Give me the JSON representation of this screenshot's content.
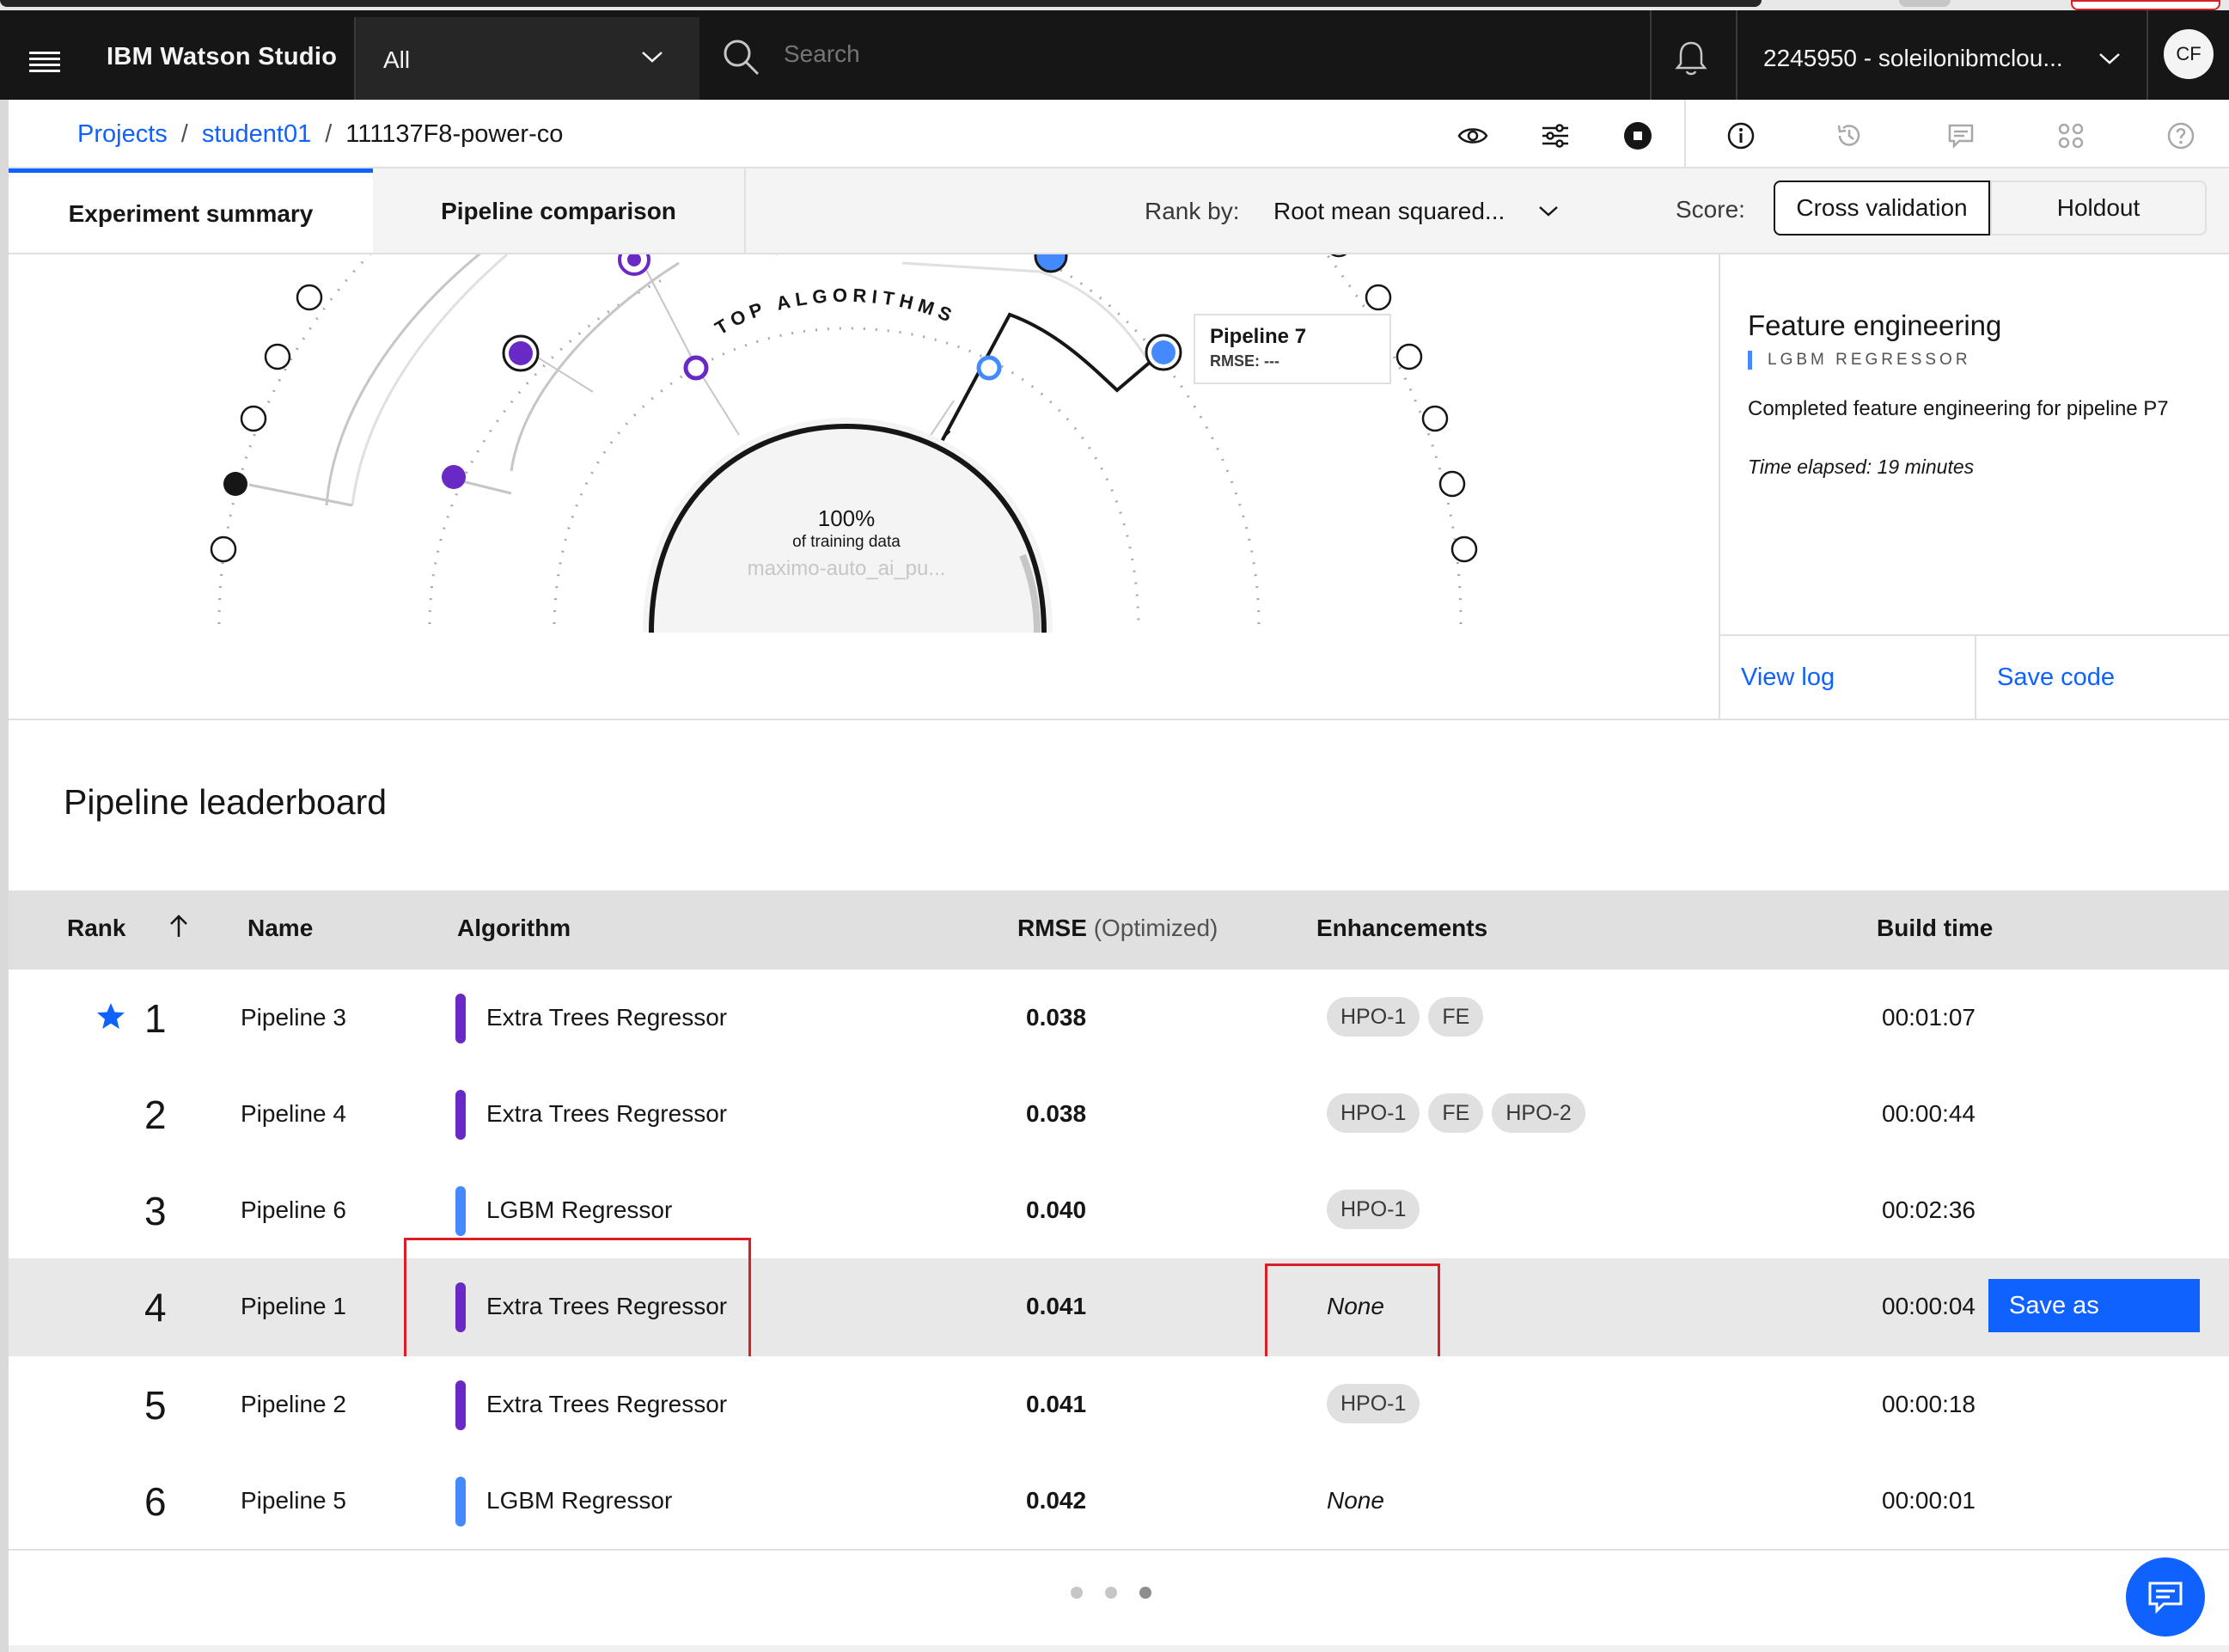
{
  "header": {
    "app_name_bold": "IBM",
    "app_name_rest": "Watson Studio",
    "scope_value": "All",
    "search_placeholder": "Search",
    "account": "2245950 - soleilonibmclou...",
    "avatar_initials": "CF"
  },
  "breadcrumb": {
    "items": [
      "Projects",
      "student01"
    ],
    "current": "111137F8-power-co",
    "separator": "/"
  },
  "tabs": {
    "experiment_summary": "Experiment summary",
    "pipeline_comparison": "Pipeline comparison"
  },
  "controls": {
    "rank_by_label": "Rank by:",
    "rank_by_value": "Root mean squared...",
    "score_label": "Score:",
    "score_options": [
      "Cross validation",
      "Holdout"
    ],
    "score_selected": "Cross validation"
  },
  "visualization": {
    "arc_label": "TOP ALGORITHMS",
    "center_percent": "100%",
    "center_caption": "of training data",
    "center_dataset": "maximo-auto_ai_pu...",
    "tooltip_title": "Pipeline 7",
    "tooltip_metric": "RMSE: ---"
  },
  "side_panel": {
    "title": "Feature engineering",
    "subtitle": "LGBM REGRESSOR",
    "description": "Completed feature engineering for pipeline P7",
    "time_elapsed": "Time elapsed: 19 minutes",
    "view_log": "View log",
    "save_code": "Save code"
  },
  "leaderboard": {
    "title": "Pipeline leaderboard",
    "columns": {
      "rank": "Rank",
      "name": "Name",
      "algorithm": "Algorithm",
      "rmse": "RMSE",
      "rmse_suffix": "(Optimized)",
      "enhancements": "Enhancements",
      "build_time": "Build time"
    },
    "rows": [
      {
        "rank": "1",
        "name": "Pipeline 3",
        "algorithm": "Extra Trees Regressor",
        "rmse": "0.038",
        "enh": [
          "HPO-1",
          "FE"
        ],
        "build": "00:01:07",
        "starred": true
      },
      {
        "rank": "2",
        "name": "Pipeline 4",
        "algorithm": "Extra Trees Regressor",
        "rmse": "0.038",
        "enh": [
          "HPO-1",
          "FE",
          "HPO-2"
        ],
        "build": "00:00:44"
      },
      {
        "rank": "3",
        "name": "Pipeline 6",
        "algorithm": "LGBM Regressor",
        "rmse": "0.040",
        "enh": [
          "HPO-1"
        ],
        "build": "00:02:36"
      },
      {
        "rank": "4",
        "name": "Pipeline 1",
        "algorithm": "Extra Trees Regressor",
        "rmse": "0.041",
        "enh_none": "None",
        "build": "00:00:04"
      },
      {
        "rank": "5",
        "name": "Pipeline 2",
        "algorithm": "Extra Trees Regressor",
        "rmse": "0.041",
        "enh": [
          "HPO-1"
        ],
        "build": "00:00:18"
      },
      {
        "rank": "6",
        "name": "Pipeline 5",
        "algorithm": "LGBM Regressor",
        "rmse": "0.042",
        "enh_none": "None",
        "build": "00:00:01"
      }
    ],
    "row_action": "Save as"
  },
  "colors": {
    "extra_trees": "#6929c4",
    "lgbm": "#4589ff",
    "primary": "#0f62fe",
    "highlight_box": "#da1e28"
  },
  "icons": [
    "menu-icon",
    "chevron-down-icon",
    "search-icon",
    "notification-icon",
    "eye-icon",
    "settings-adjust-icon",
    "stop-icon",
    "information-icon",
    "history-icon",
    "comment-icon",
    "apps-icon",
    "help-icon",
    "star-icon",
    "arrow-up-icon",
    "chat-icon"
  ]
}
